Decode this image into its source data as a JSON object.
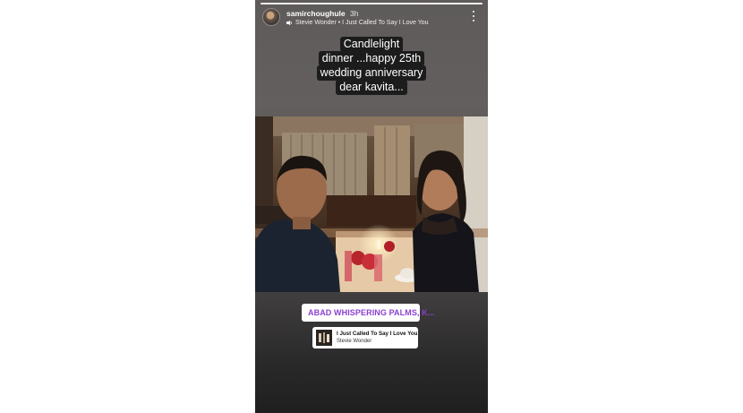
{
  "story": {
    "username": "samirchoughule",
    "time": "3h",
    "music_line": "Stevie Wonder • I Just Called To Say I Love You",
    "caption_lines": [
      "Candlelight",
      "dinner ...happy 25th",
      "wedding anniversary",
      "dear kavita..."
    ],
    "location": "ABAD WHISPERING PALMS, K...",
    "music_sticker": {
      "song": "I Just Called To Say I Love You",
      "artist": "Stevie Wonder"
    }
  },
  "icons": {
    "avatar": "avatar",
    "music": "music-note-icon",
    "more": "more-vertical-icon",
    "location": "location-pin-icon",
    "album": "album-art-icon"
  },
  "colors": {
    "location_text": "#8a3fd0",
    "caption_bg": "#1c1c1c"
  }
}
